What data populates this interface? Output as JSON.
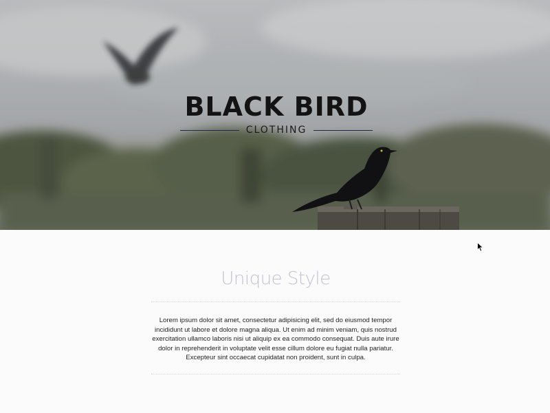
{
  "hero": {
    "brand_title": "BLACK BIRD",
    "brand_subtitle": "CLOTHING"
  },
  "section": {
    "title": "Unique Style",
    "body": "Lorem ipsum dolor sit amet, consectetur adipisicing elit, sed do eiusmod tempor incididunt ut labore et dolore magna aliqua. Ut enim ad minim veniam, quis nostrud exercitation ullamco laboris nisi ut aliquip ex ea commodo consequat. Duis aute irure dolor in reprehenderit in voluptate velit esse cillum dolore eu fugiat nulla pariatur. Excepteur sint occaecat cupidatat non proident, sunt in culpa."
  },
  "colors": {
    "title_accent": "#c4c1d3",
    "brand_line": "#23274a",
    "text": "#222222"
  },
  "icons": {
    "cursor": "mouse-pointer-icon"
  }
}
